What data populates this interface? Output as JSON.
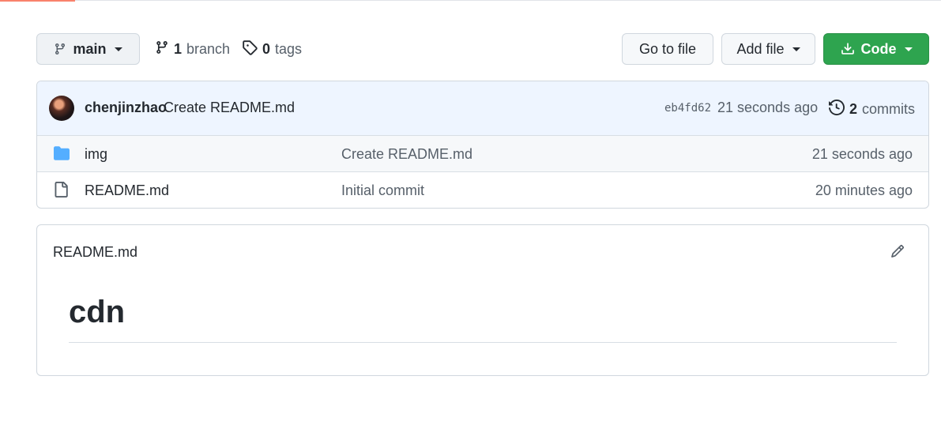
{
  "branch_selector": {
    "label": "main"
  },
  "branches": {
    "count": "1",
    "label": "branch"
  },
  "tags": {
    "count": "0",
    "label": "tags"
  },
  "actions": {
    "go_to_file": "Go to file",
    "add_file": "Add file",
    "code": "Code"
  },
  "latest_commit": {
    "author": "chenjinzhao",
    "message": "Create README.md",
    "sha": "eb4fd62",
    "time": "21 seconds ago",
    "commits_count": "2",
    "commits_label": "commits"
  },
  "files": [
    {
      "type": "folder",
      "icon": "folder-icon",
      "name": "img",
      "message": "Create README.md",
      "age": "21 seconds ago"
    },
    {
      "type": "file",
      "icon": "file-icon",
      "name": "README.md",
      "message": "Initial commit",
      "age": "20 minutes ago"
    }
  ],
  "readme": {
    "title": "README.md",
    "heading": "cdn"
  },
  "colors": {
    "accent_green": "#2ea44f",
    "folder_blue": "#54aeff",
    "progress_orange": "#f9826c",
    "commit_bar_bg": "#eef5ff"
  }
}
